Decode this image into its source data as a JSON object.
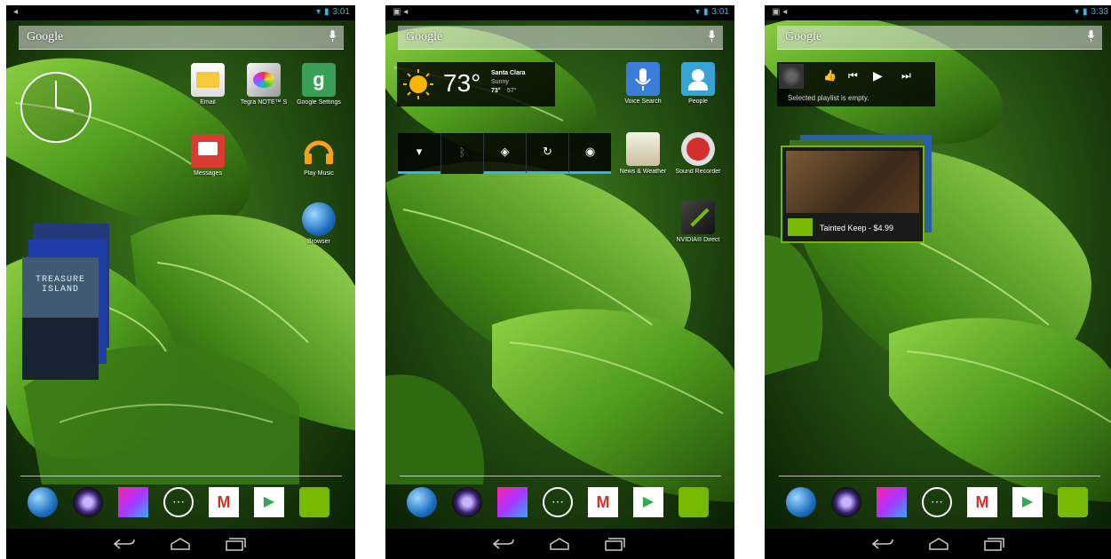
{
  "colors": {
    "accent": "#33b5e5",
    "leaf": "#5aa326",
    "statusbar": "#000000"
  },
  "screens": [
    {
      "status": {
        "time": "3:01"
      },
      "search": {
        "label": "Google"
      },
      "apps": [
        {
          "label": "Email",
          "icon": "email-icon"
        },
        {
          "label": "Tegra NOTE™ S",
          "icon": "tegra-note-icon"
        },
        {
          "label": "Google Settings",
          "icon": "google-settings-icon"
        },
        {
          "label": "Messages",
          "icon": "messages-icon"
        },
        {
          "label": "Play Music",
          "icon": "headphones-icon"
        },
        {
          "label": "Browser",
          "icon": "globe-icon"
        }
      ],
      "book": {
        "line1": "TREASURE",
        "line2": "ISLAND"
      }
    },
    {
      "status": {
        "time": "3:01"
      },
      "search": {
        "label": "Google"
      },
      "weather": {
        "temp": "73°",
        "city": "Santa Clara",
        "condition": "Sunny",
        "high": "73°",
        "low": "57°"
      },
      "apps": [
        {
          "label": "Voice Search",
          "icon": "voice-search-icon"
        },
        {
          "label": "People",
          "icon": "people-icon"
        },
        {
          "label": "News & Weather",
          "icon": "news-weather-icon"
        },
        {
          "label": "Sound Recorder",
          "icon": "sound-recorder-icon"
        },
        {
          "label": "NVIDIA® Direct",
          "icon": "nvidia-direct-icon"
        }
      ],
      "toggles": [
        "wifi-icon",
        "bluetooth-icon",
        "gps-icon",
        "sync-icon",
        "brightness-icon"
      ]
    },
    {
      "status": {
        "time": "3:33"
      },
      "search": {
        "label": "Google"
      },
      "music": {
        "message": "Selected playlist is empty."
      },
      "game": {
        "caption": "Tainted Keep - $4.99"
      }
    }
  ],
  "dock": [
    "globe-icon",
    "camera-icon",
    "gallery-icon",
    "all-apps-icon",
    "gmail-icon",
    "play-store-icon",
    "nvidia-icon"
  ],
  "nav": [
    "back-icon",
    "home-icon",
    "recents-icon"
  ]
}
